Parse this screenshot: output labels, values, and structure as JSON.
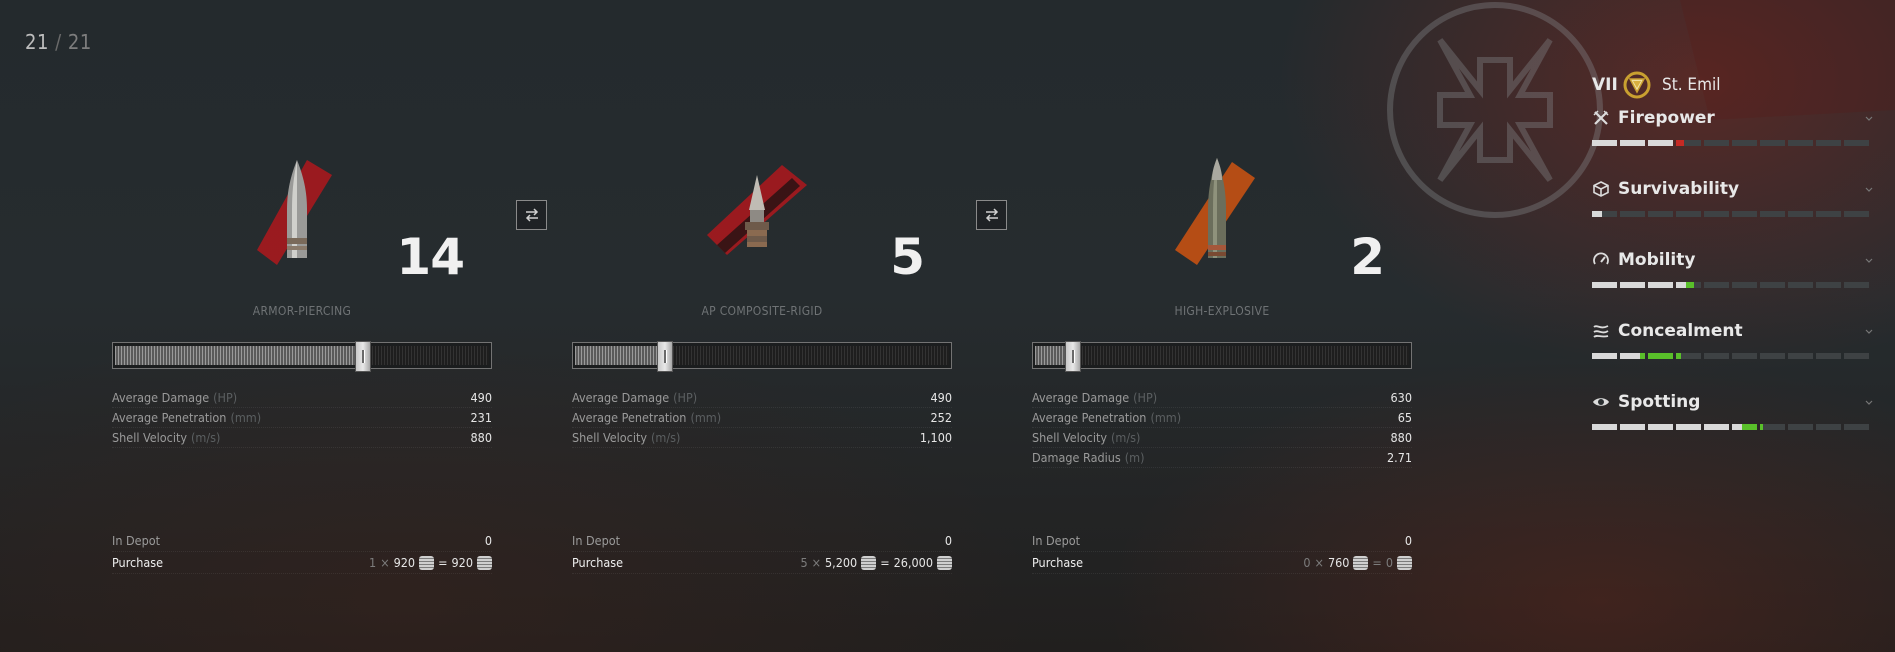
{
  "counter": {
    "current": "21",
    "separator": "/",
    "total": "21"
  },
  "shells": [
    {
      "count": "14",
      "name": "ARMOR-PIERCING",
      "slider_fraction": 0.66,
      "stats": [
        {
          "label": "Average Damage",
          "unit": "(HP)",
          "value": "490"
        },
        {
          "label": "Average Penetration",
          "unit": "(mm)",
          "value": "231"
        },
        {
          "label": "Shell Velocity",
          "unit": "(m/s)",
          "value": "880"
        }
      ],
      "in_depot_label": "In Depot",
      "in_depot_value": "0",
      "purchase_label": "Purchase",
      "purchase_qty": "1",
      "purchase_times": "×",
      "purchase_price": "920",
      "purchase_equals": "=",
      "purchase_total": "920",
      "accent": "#c2161b"
    },
    {
      "count": "5",
      "name": "AP COMPOSITE-RIGID",
      "slider_fraction": 0.24,
      "stats": [
        {
          "label": "Average Damage",
          "unit": "(HP)",
          "value": "490"
        },
        {
          "label": "Average Penetration",
          "unit": "(mm)",
          "value": "252"
        },
        {
          "label": "Shell Velocity",
          "unit": "(m/s)",
          "value": "1,100"
        }
      ],
      "in_depot_label": "In Depot",
      "in_depot_value": "0",
      "purchase_label": "Purchase",
      "purchase_qty": "5",
      "purchase_times": "×",
      "purchase_price": "5,200",
      "purchase_equals": "=",
      "purchase_total": "26,000",
      "accent": "#c2161b"
    },
    {
      "count": "2",
      "name": "HIGH-EXPLOSIVE",
      "slider_fraction": 0.1,
      "stats": [
        {
          "label": "Average Damage",
          "unit": "(HP)",
          "value": "630"
        },
        {
          "label": "Average Penetration",
          "unit": "(mm)",
          "value": "65"
        },
        {
          "label": "Shell Velocity",
          "unit": "(m/s)",
          "value": "880"
        },
        {
          "label": "Damage Radius",
          "unit": "(m)",
          "value": "2.71"
        }
      ],
      "in_depot_label": "In Depot",
      "in_depot_value": "0",
      "purchase_label": "Purchase",
      "purchase_qty": "0",
      "purchase_times": "×",
      "purchase_price": "760",
      "purchase_equals": "=",
      "purchase_total": "0",
      "accent": "#d9560f"
    }
  ],
  "vehicle": {
    "tier": "VII",
    "name": "St. Emil"
  },
  "attributes": [
    {
      "title": "Firepower",
      "icon": "crossed-guns-icon",
      "white": 3.0,
      "green": 0,
      "red": 0.3
    },
    {
      "title": "Survivability",
      "icon": "cube-icon",
      "white": 0.4,
      "green": 0,
      "red": 0
    },
    {
      "title": "Mobility",
      "icon": "speedometer-icon",
      "white": 3.4,
      "green": 0.3,
      "red": 0
    },
    {
      "title": "Concealment",
      "icon": "camo-icon",
      "white": 1.8,
      "green": 1.4,
      "red": 0
    },
    {
      "title": "Spotting",
      "icon": "eye-icon",
      "white": 5.4,
      "green": 0.7,
      "red": 0
    }
  ],
  "colors": {
    "bonus": "#59c02a",
    "penalty": "#c52a24",
    "ap_accent": "#c2161b",
    "he_accent": "#d9560f"
  }
}
